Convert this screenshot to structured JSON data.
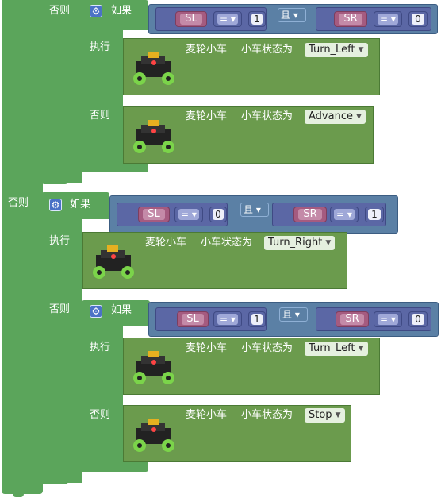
{
  "keywords": {
    "if": "如果",
    "then": "执行",
    "else": "否则",
    "and": "且"
  },
  "block_label": {
    "module": "麦轮小车",
    "setter": "小车状态为"
  },
  "icons": {
    "gear": "gear-icon",
    "dropdown": "dropdown-arrow-icon",
    "robot": "mecanum-car-image"
  },
  "colors": {
    "control": "#5ba55b",
    "logic": "#5b80a5",
    "variable": "#a55b80",
    "math": "#5b67a5",
    "action": "#6b9b4d"
  },
  "if1": {
    "left_var": "SL",
    "left_op": "=",
    "left_val": "1",
    "right_var": "SR",
    "right_op": "=",
    "right_val": "0",
    "then_state": "Turn_Left",
    "else_state": "Advance"
  },
  "if2": {
    "left_var": "SL",
    "left_op": "=",
    "left_val": "0",
    "right_var": "SR",
    "right_op": "=",
    "right_val": "1",
    "then_state": "Turn_Right"
  },
  "if3": {
    "left_var": "SL",
    "left_op": "=",
    "left_val": "1",
    "right_var": "SR",
    "right_op": "=",
    "right_val": "0",
    "then_state": "Turn_Left",
    "else_state": "Stop"
  }
}
